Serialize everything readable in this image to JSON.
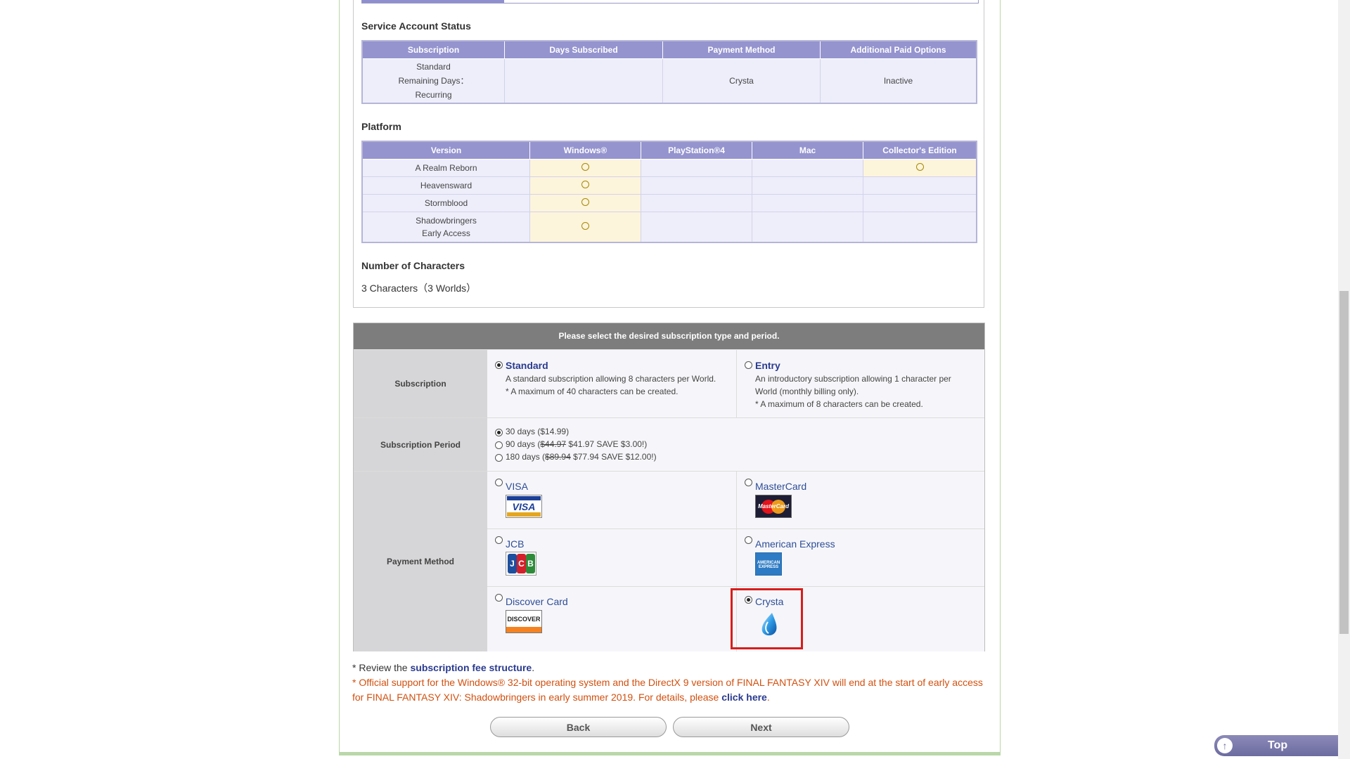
{
  "account_status": {
    "heading": "Service Account Status",
    "columns": [
      "Subscription",
      "Days Subscribed",
      "Payment Method",
      "Additional Paid Options"
    ],
    "subscription_lines": [
      "Standard",
      "Remaining Days：",
      "Recurring"
    ],
    "days_subscribed": "",
    "payment_method": "Crysta",
    "additional_paid_options": "Inactive"
  },
  "platform": {
    "heading": "Platform",
    "columns": [
      "Version",
      "Windows®",
      "PlayStation®4",
      "Mac",
      "Collector's Edition"
    ],
    "rows": [
      {
        "version": "A Realm Reborn",
        "windows": true,
        "ps4": false,
        "mac": false,
        "collectors": true
      },
      {
        "version": "Heavensward",
        "windows": true,
        "ps4": false,
        "mac": false,
        "collectors": false
      },
      {
        "version": "Stormblood",
        "windows": true,
        "ps4": false,
        "mac": false,
        "collectors": false
      },
      {
        "version_line1": "Shadowbringers",
        "version_line2": "Early Access",
        "windows": true,
        "ps4": false,
        "mac": false,
        "collectors": false
      }
    ]
  },
  "characters": {
    "heading": "Number of Characters",
    "value": "3 Characters（3 Worlds）"
  },
  "subscription_form": {
    "header": "Please select the desired subscription type and period.",
    "subscription_label": "Subscription",
    "standard": {
      "title": "Standard",
      "desc1": "A standard subscription allowing 8 characters per World.",
      "desc2": "* A maximum of 40 characters can be created.",
      "selected": true
    },
    "entry": {
      "title": "Entry",
      "desc1": "An introductory subscription allowing 1 character per",
      "desc2": "World (monthly billing only).",
      "desc3": "* A maximum of 8 characters can be created.",
      "selected": false
    },
    "period_label": "Subscription Period",
    "periods": [
      {
        "text": "30 days ($14.99)",
        "selected": true
      },
      {
        "prefix": "90 days (",
        "old": "$44.97",
        "new": " $41.97 SAVE $3.00!)",
        "selected": false
      },
      {
        "prefix": "180 days (",
        "old": "$89.94",
        "new": " $77.94 SAVE $12.00!)",
        "selected": false
      }
    ],
    "payment_label": "Payment Method",
    "payments": {
      "visa": "VISA",
      "mastercard": "MasterCard",
      "jcb": "JCB",
      "amex": "American Express",
      "discover": "Discover Card",
      "crysta": "Crysta"
    },
    "selected_payment": "crysta",
    "logo_text": {
      "visa": "VISA",
      "mastercard": "MasterCard",
      "amex": "AMERICAN EXPRESS",
      "discover": "DISCOVER"
    }
  },
  "notes": {
    "note1_prefix": "* Review the ",
    "note1_link": "subscription fee structure",
    "note1_suffix": ".",
    "note2_text": "* Official support for the Windows® 32-bit operating system and the DirectX 9 version of FINAL FANTASY XIV will end at the start of early access for FINAL FANTASY XIV: Shadowbringers in early summer 2019. For details, please ",
    "note2_link": "click here",
    "note2_suffix": "."
  },
  "buttons": {
    "back": "Back",
    "next": "Next"
  },
  "top_button": "Top",
  "colors": {
    "table_header": "#9594cf",
    "highlight_cell": "#fdf4dc",
    "link": "#2a3b8f",
    "warning_text": "#d2500f",
    "selection_box": "#d81d1d"
  }
}
